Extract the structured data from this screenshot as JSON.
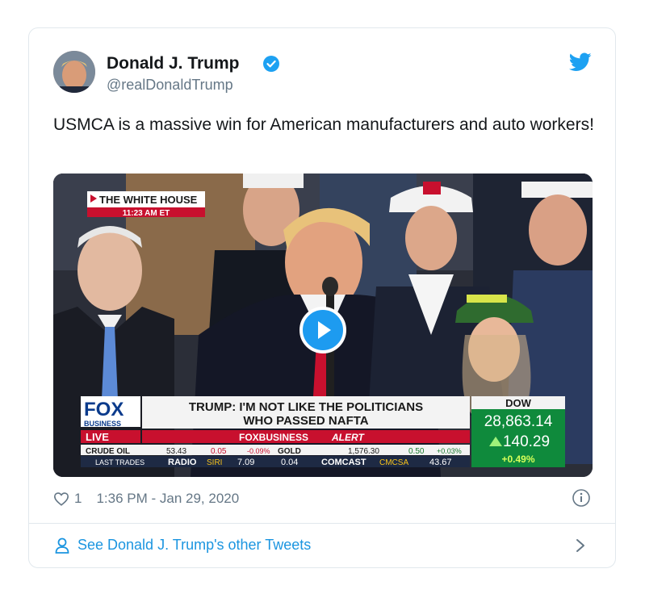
{
  "tweet": {
    "author_name": "Donald J. Trump",
    "author_handle": "@realDonaldTrump",
    "text": "USMCA is a massive win for American manufacturers and auto workers!",
    "likes": "1",
    "timestamp": "1:36 PM - Jan 29, 2020",
    "footer_link": "See Donald J. Trump's other Tweets"
  },
  "video": {
    "location_tag": "THE WHITE HOUSE",
    "location_time": "11:23 AM ET",
    "network_logo": "FOX",
    "network_sub": "BUSINESS",
    "live_label": "LIVE",
    "headline_line1": "TRUMP: I'M NOT LIKE THE POLITICIANS",
    "headline_line2": "WHO PASSED NAFTA",
    "alert_brand": "FOXBUSINESS",
    "alert_word": "ALERT",
    "dow_label": "DOW",
    "dow_value": "28,863.14",
    "dow_change": "140.29",
    "dow_percent": "+0.49%",
    "ticker_row1": {
      "label": "CRUDE OIL",
      "value1": "53.43",
      "change1": "0.05",
      "pct1": "-0.09%",
      "label2": "GOLD",
      "value2": "1,576.30",
      "change2": "0.50",
      "pct2": "+0.03%"
    },
    "ticker_row2": {
      "label": "LAST TRADES",
      "item1": "RADIO",
      "symbol1": "SIRI",
      "value1": "7.09",
      "change1": "0.04",
      "item2": "COMCAST",
      "symbol2": "CMCSA",
      "value2": "43.67"
    }
  },
  "colors": {
    "accent_blue": "#1da1f2",
    "link_blue": "#1b95e0",
    "text_dark": "#14171a",
    "text_muted": "#657786",
    "border": "#e1e8ed",
    "dow_green": "#0f8a3c",
    "fox_red": "#c8102e"
  },
  "icons": [
    "verified-badge-icon",
    "twitter-bird-icon",
    "play-icon",
    "heart-icon",
    "info-icon",
    "person-icon",
    "chevron-right-icon"
  ]
}
